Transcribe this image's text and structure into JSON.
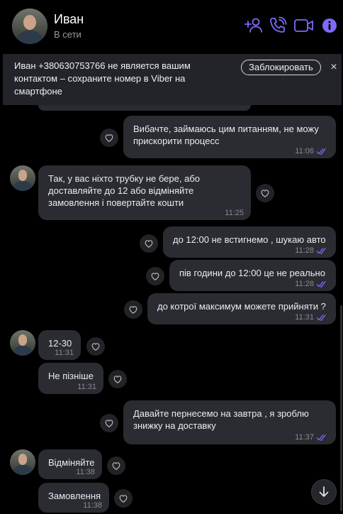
{
  "header": {
    "name": "Иван",
    "status": "В сети",
    "icons": [
      "add-contact-icon",
      "call-icon",
      "video-call-icon",
      "info-icon"
    ],
    "accent_color": "#7b6cf6"
  },
  "banner": {
    "text": "Иван +380630753766 не является вашим контактом – сохраните номер в Viber на смартфоне",
    "block_label": "Заблокировать",
    "close_label": "×"
  },
  "messages": [
    {
      "dir": "out",
      "lines": [
        "Вибачте, займаюсь цим питанням, не можу",
        "прискорити процесс"
      ],
      "time": "11:06",
      "read": true
    },
    {
      "dir": "in",
      "lines": [
        "Так, у вас ніхто трубку не бере, або",
        "доставляйте до 12 або відміняйте",
        "замовлення і повертайте кошти"
      ],
      "time": "11:25"
    },
    {
      "dir": "out",
      "lines": [
        "до 12:00 не встигнемо , шукаю авто"
      ],
      "time": "11:28",
      "read": true
    },
    {
      "dir": "out",
      "lines": [
        "пів години до 12:00 це не реально"
      ],
      "time": "11:28",
      "read": true
    },
    {
      "dir": "out",
      "lines": [
        "до котрої максимум можете прийняти ?"
      ],
      "time": "11:31",
      "read": true
    },
    {
      "dir": "in",
      "lines": [
        "12-30"
      ],
      "time": "11:31"
    },
    {
      "dir": "in",
      "lines": [
        "Не пізніше"
      ],
      "time": "11:31"
    },
    {
      "dir": "out",
      "lines": [
        "Давайте пернесемо на завтра , я зроблю",
        "знижку на доставку"
      ],
      "time": "11:37",
      "read": true
    },
    {
      "dir": "in",
      "lines": [
        "Відміняйте"
      ],
      "time": "11:38"
    },
    {
      "dir": "in",
      "lines": [
        "Замовлення"
      ],
      "time": "11:38"
    }
  ]
}
